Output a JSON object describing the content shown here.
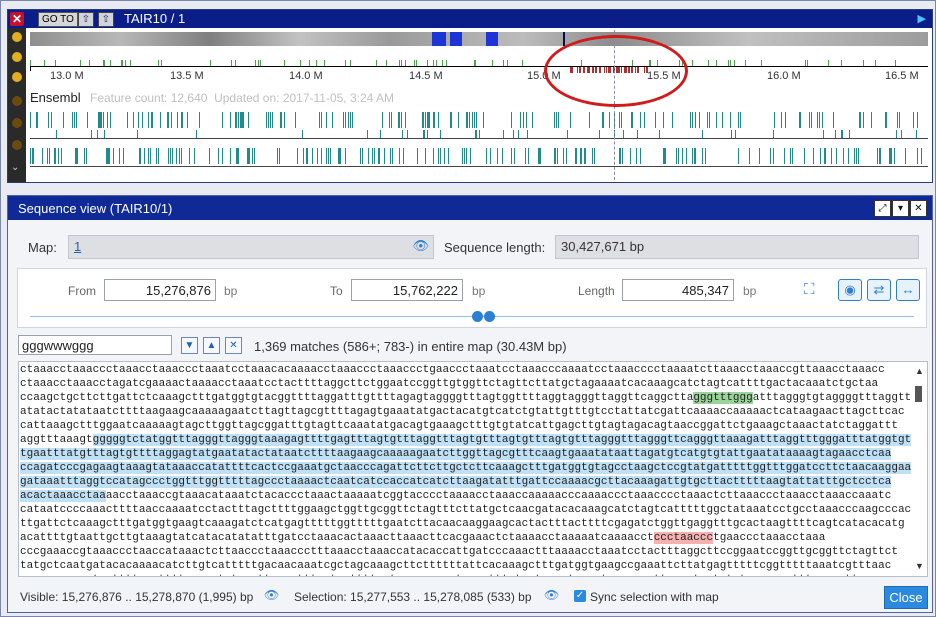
{
  "map_window": {
    "title": "TAIR10 / 1",
    "goto_label": "GO TO",
    "close_glyph": "✕",
    "ruler_ticks": [
      "13.0 M",
      "13.5 M",
      "14.0 M",
      "14.5 M",
      "15.0 M",
      "15.5 M",
      "16.0 M",
      "16.5 M"
    ],
    "track": {
      "name": "Ensembl",
      "feature_count": "Feature count: 12,640",
      "updated": "Updated on: 2017-11-05, 3:24 AM"
    }
  },
  "sequence_view": {
    "title": "Sequence view (TAIR10/1)",
    "map_label": "Map:",
    "map_value": "1",
    "seq_length_label": "Sequence length:",
    "seq_length_value": "30,427,671 bp",
    "from_label": "From",
    "from_value": "15,276,876",
    "to_label": "To",
    "to_value": "15,762,222",
    "length_label": "Length",
    "length_value": "485,347",
    "unit": "bp",
    "search_value": "gggwwwggg",
    "matches": "1,369 matches (586+; 783-) in entire map (30.43M bp)",
    "visible": "Visible: 15,276,876 .. 15,278,870 (1,995) bp",
    "selection": "Selection: 15,277,553 .. 15,278,085 (533) bp",
    "sync_label": "Sync selection with map",
    "close_label": "Close",
    "sequence_lines": [
      {
        "segments": [
          {
            "t": "ctaaacctaaaccctaaacctaaaccctaaatcctaaacacaaaacctaaaccctaaaccctgaaccctaaatcctaaacccaaaatcctaaacccctaaaatcttaaacctaaaccgttaaacctaaacc"
          }
        ]
      },
      {
        "segments": [
          {
            "t": "ctaaacctaaacctagatcgaaaactaaaacctaaatcctacttttaggcttctggaatccggttgtggttctagttcttatgctagaaaatcacaaagcatctagtcattttgactacaaatctgctaa"
          }
        ]
      },
      {
        "segments": [
          {
            "t": "ccaagctgcttcttgattctcaaagctttgatggtgtacggttttaggatttgttttagagtaggggtttagtggttttaggtagggttaggttcaggctta"
          },
          {
            "t": "gggtttggg",
            "h": "green"
          },
          {
            "t": "atttagggtgtaggggtttaggttagtgttaggtaa"
          }
        ]
      },
      {
        "segments": [
          {
            "t": "atatactatataatcttttaagaagcaaaaagaatcttagttagcgttttagagtgaaatatgactacatgtcatctgtattgtttgtcctattatcgattcaaaaccaaaaactcataagaacttagcttcac"
          }
        ]
      },
      {
        "segments": [
          {
            "t": "cattaaagctttggaatcaaaaagtagcttggttagcggatttgtagttcaaatatgacagtgaaagctttgtgtatcattgagcttgtagtagacagtaaccggattctgaaagctaaactatctaggattt"
          }
        ]
      },
      {
        "segments": [
          {
            "t": "aggtttaaagt"
          },
          {
            "t": "gggggtctatggtttagggttagggtaaagagttttgagtttagtgtttaggtttagtgtttagtgtttagtgtttagggtttagggttcagggttaaagatttaggtttgggatttatggtgt",
            "h": "blue"
          }
        ]
      },
      {
        "segments": [
          {
            "t": "tgaatttatgtttagtgttttaggagtatgaatatactataatcttttaagaagcaaaaagaatcttggttagcgtttcaagtgaaatataattagatgtcatgtgtattgaatataaaagtagaacctcaa",
            "h": "blue"
          }
        ]
      },
      {
        "segments": [
          {
            "t": "ccagatcccgagaagtaaagtataaaccatattttcactccgaaatgctaacccagattcttcttgctcttcaaagctttgatggtgtagcctaagctccgtatgatttttggtttggatccttctaacaaggaaa",
            "h": "blue"
          }
        ]
      },
      {
        "segments": [
          {
            "t": "gataaatttaggtccatagccctggtttggtttttagccctaaaactcaatcatccaccatcatcttaagatatttgattccaaaacgcttacaaagattgtgcttactttttaagtattatttgctcctca",
            "h": "blue"
          }
        ]
      },
      {
        "segments": [
          {
            "t": "acactaaacctaa",
            "h": "blue"
          },
          {
            "t": "aacctaaaccgtaaacataaatctacaccctaaactaaaaatcggtacccctaaaacctaaaccaaaaacccaaaaccctaaacccctaaactcttaaaccctaaacctaaaccaaatc"
          }
        ]
      },
      {
        "segments": [
          {
            "t": "cataatccccaaacttttaaccaaaatcctactttagcttttggaagctggttgcggttctagtttcttatgctcaacgatacacaaagcatctagtcatttttggctataaatcctgcctaaacccaagcccacttc"
          }
        ]
      },
      {
        "segments": [
          {
            "t": "ttgattctcaaagctttgatggtgaagtcaaagatctcatgagtttttggtttttgaatcttacaacaaggaagcactactttacttttcgagatctggttgaggtttgcactaagttttcagtcatacacatg"
          }
        ]
      },
      {
        "segments": [
          {
            "t": "acattttgtaattgcttgtaaagtatcatacatatatttgatcctaaacactaaacttaaacttcacgaaactctaaaacctaaaaatcaaaacct"
          },
          {
            "t": "ccctaaccc",
            "h": "red"
          },
          {
            "t": "tgaaccctaaacctaaa"
          }
        ]
      },
      {
        "segments": [
          {
            "t": "cccgaaaccgtaaaccctaaccataaactcttaaccctaaaccctttaaacctaaaccatacaccattgatcccaaactttaaaacctaaatcctactttaggcttccggaatccggttgcggttctagttct"
          }
        ]
      },
      {
        "segments": [
          {
            "t": "tatgctcaatgatacacaaaacatcttgtcatttttgacaacaaatcgctagcaaagcttcttttttattcacaaagctttgatggtgaagccgaaattcttatgagtttttcggtttttaaatcgtttaac"
          }
        ]
      },
      {
        "segments": [
          {
            "t": "aaaggaagcactacttttaagttttcgagatctgggttgaggtttggtagttttggtgccaaagcatggagtttatgctgggctaacctcaccgaattaacctgctatgtggaaacgtttaaccctt"
          }
        ]
      }
    ]
  },
  "colors": {
    "title_bar": "#0b1d87",
    "seq_title_bar": "#0f2a96",
    "feature": "#1f8c8c",
    "selection_highlight": "#bfe0f5",
    "match_green": "#9ad49a",
    "match_red": "#f5b0b0",
    "accent": "#2b8ae0",
    "annotation_circle": "#d11a1a"
  }
}
